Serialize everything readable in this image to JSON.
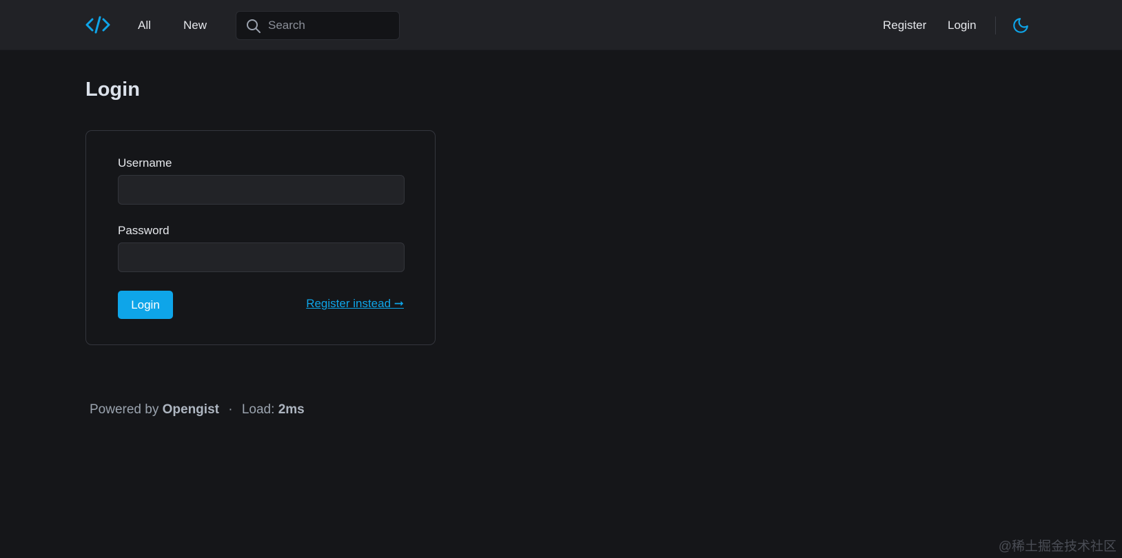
{
  "header": {
    "logo_icon": "code-brackets-icon",
    "nav": {
      "all": "All",
      "new": "New",
      "register": "Register",
      "login": "Login"
    },
    "search": {
      "placeholder": "Search",
      "icon": "search-icon"
    },
    "theme_toggle_icon": "moon-icon"
  },
  "page": {
    "title": "Login"
  },
  "form": {
    "username_label": "Username",
    "username_value": "",
    "password_label": "Password",
    "password_value": "",
    "submit_label": "Login",
    "register_link": "Register instead ➞"
  },
  "footer": {
    "powered_by": "Powered by",
    "app_name": "Opengist",
    "separator": "·",
    "load_label": "Load:",
    "load_value": "2ms"
  },
  "watermark": "@稀土掘金技术社区",
  "colors": {
    "accent": "#0ea5e9",
    "background": "#151619",
    "header_background": "#212226"
  }
}
